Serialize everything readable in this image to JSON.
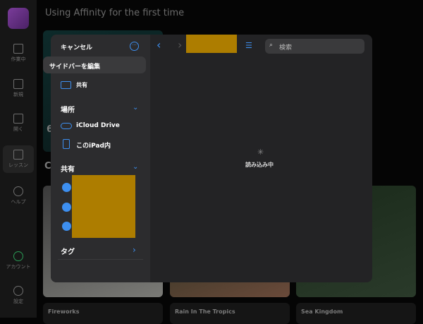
{
  "app": {
    "title": "Using Affinity for the first time"
  },
  "nav": [
    {
      "label": "作業中"
    },
    {
      "label": "新規"
    },
    {
      "label": "開く"
    },
    {
      "label": "レッスン"
    },
    {
      "label": "ヘルプ"
    },
    {
      "label": "アカウント"
    },
    {
      "label": "設定"
    }
  ],
  "background": {
    "section_initial": "C",
    "row1_initial": "6",
    "cards": [
      {
        "title": "Fireworks"
      },
      {
        "title": "Rain In The Tropics"
      },
      {
        "title": "Sea Kingdom"
      }
    ]
  },
  "picker": {
    "cancel": "キャンセル",
    "edit_sidebar": "サイドバーを編集",
    "shared_item": "共有",
    "locations_header": "場所",
    "locations": [
      {
        "label": "iCloud Drive"
      },
      {
        "label": "このiPad内"
      }
    ],
    "shared_header": "共有",
    "tags_header": "タグ",
    "search_placeholder": "検索",
    "loading": "読み込み中",
    "accent": "#3d8ff0"
  }
}
